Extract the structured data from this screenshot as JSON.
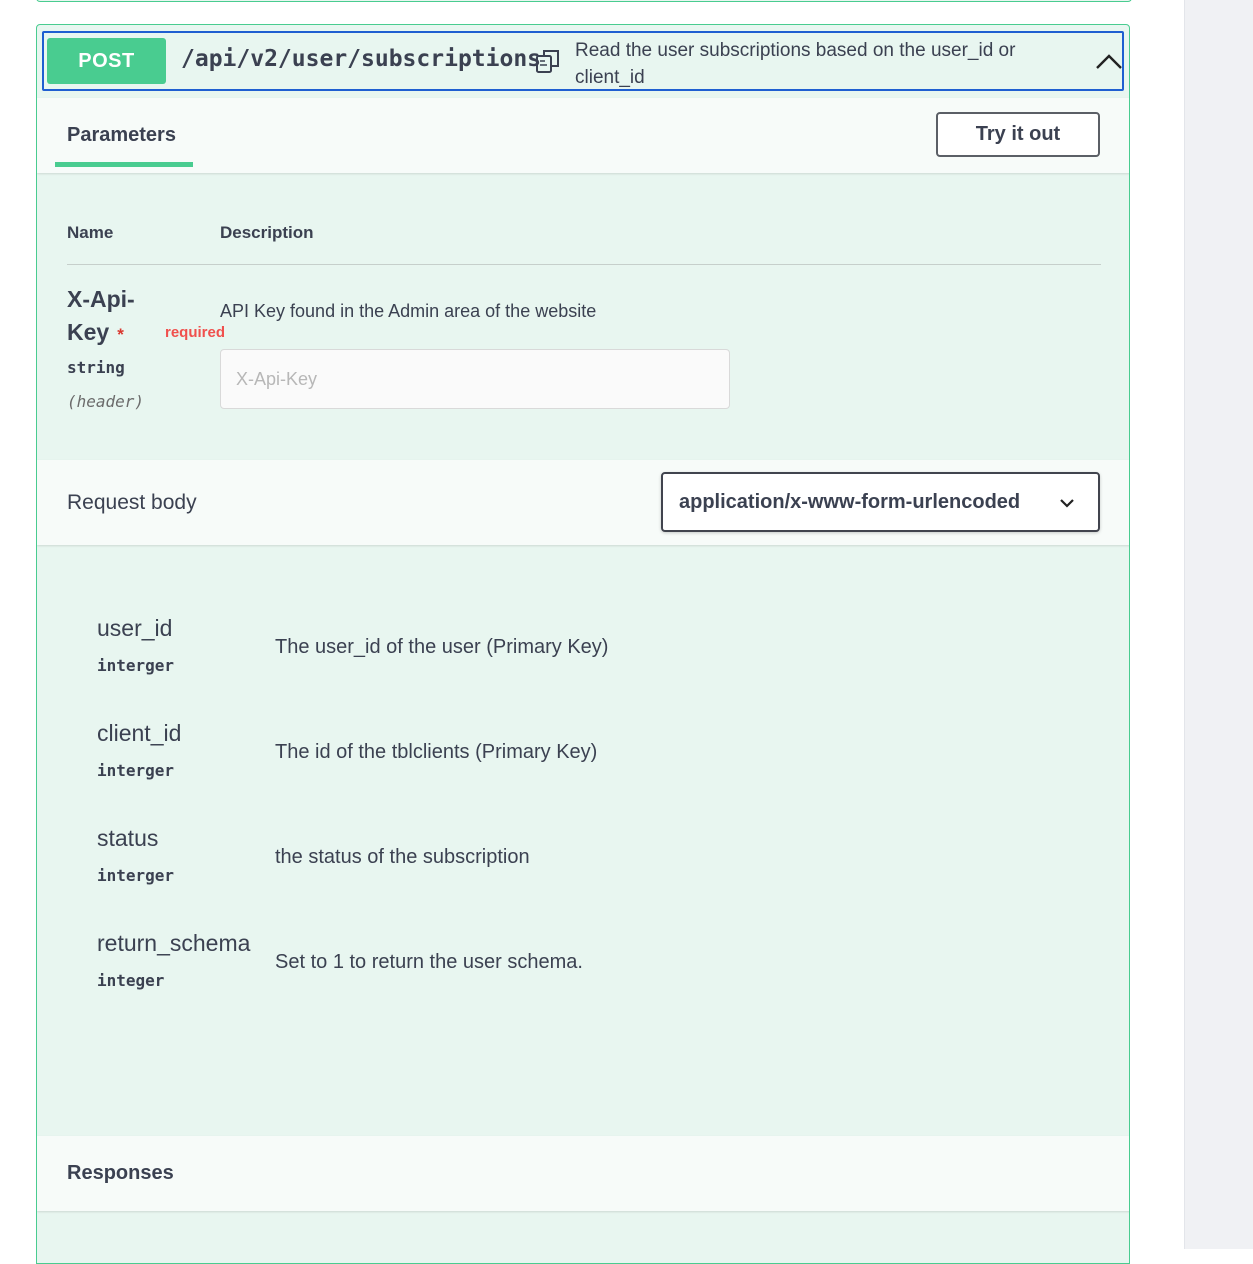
{
  "operation": {
    "method": "POST",
    "path": "/api/v2/user/subscriptions",
    "description": "Read the user subscriptions based on the user_id or client_id"
  },
  "tabs": {
    "parameters": "Parameters",
    "try_it_out": "Try it out"
  },
  "parameters_table": {
    "col_name": "Name",
    "col_description": "Description",
    "param": {
      "name_line1": "X-Api-",
      "name_line2": "Key",
      "star": "*",
      "required": "required",
      "type": "string",
      "in": "(header)",
      "description": "API Key found in the Admin area of the website",
      "placeholder": "X-Api-Key"
    }
  },
  "request_body": {
    "label": "Request body",
    "content_type": "application/x-www-form-urlencoded",
    "fields": [
      {
        "name": "user_id",
        "type": "interger",
        "description": "The user_id of the user (Primary Key)"
      },
      {
        "name": "client_id",
        "type": "interger",
        "description": "The id of the tblclients (Primary Key)"
      },
      {
        "name": "status",
        "type": "interger",
        "description": "the status of the subscription"
      },
      {
        "name": "return_schema",
        "type": "integer",
        "description": "Set to 1 to return the user schema."
      }
    ]
  },
  "responses": {
    "label": "Responses"
  },
  "colors": {
    "post_green": "#49cc90",
    "block_bg": "#e8f6f0",
    "focus_blue": "#1f5fd1",
    "required_red": "#f0504d"
  },
  "icons": {
    "copy": "copy-icon",
    "collapse": "chevron-up-icon",
    "select": "chevron-down-icon"
  }
}
